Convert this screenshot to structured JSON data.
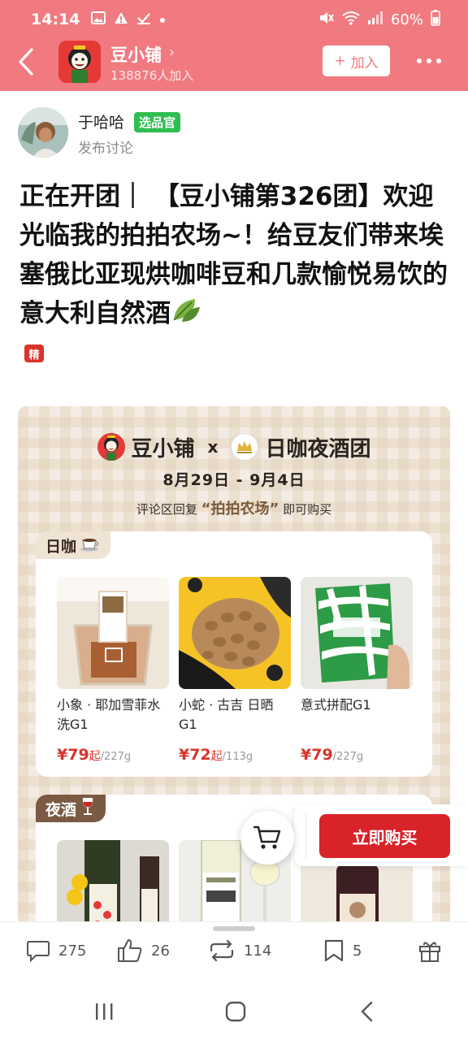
{
  "status_bar": {
    "time": "14:14",
    "battery": "60%"
  },
  "header": {
    "group_name": "豆小铺",
    "chevron": "›",
    "members": "138876人加入",
    "join_label": "加入",
    "join_plus": "+"
  },
  "author": {
    "name": "于哈哈",
    "badge": "选品官",
    "subtitle": "发布讨论"
  },
  "post": {
    "title": "正在开团｜ 【豆小铺第326团】欢迎光临我的拍拍农场~！给豆友们带来埃塞俄比亚现烘咖啡豆和几款愉悦易饮的意大利自然酒",
    "featured_badge": "精"
  },
  "poster": {
    "brand_left": "豆小铺",
    "x": "x",
    "brand_right": "日咖夜酒团",
    "dates": "8月29日 - 9月4日",
    "reply_prefix": "评论区回复",
    "reply_keyword": "“拍拍农场”",
    "reply_suffix": "即可购买",
    "sections": [
      {
        "label": "日咖",
        "emoji": "☕",
        "products": [
          {
            "name": "小象 · 耶加雪菲水洗G1",
            "price": "¥79",
            "from": "起",
            "unit": "/227g"
          },
          {
            "name": "小蛇 · 古吉 日晒G1",
            "price": "¥72",
            "from": "起",
            "unit": "/113g"
          },
          {
            "name": "意式拼配G1",
            "price": "¥79",
            "from": "",
            "unit": "/227g"
          }
        ]
      },
      {
        "label": "夜酒",
        "emoji": "🍷"
      }
    ]
  },
  "floating": {
    "buy_label": "立即购买"
  },
  "actions": {
    "comments": "275",
    "likes": "26",
    "reshares": "114",
    "saves": "5"
  },
  "colors": {
    "header_pink": "#f07a80",
    "buy_red": "#d8232a",
    "price_red": "#d9342b",
    "badge_green": "#2fbe52"
  }
}
